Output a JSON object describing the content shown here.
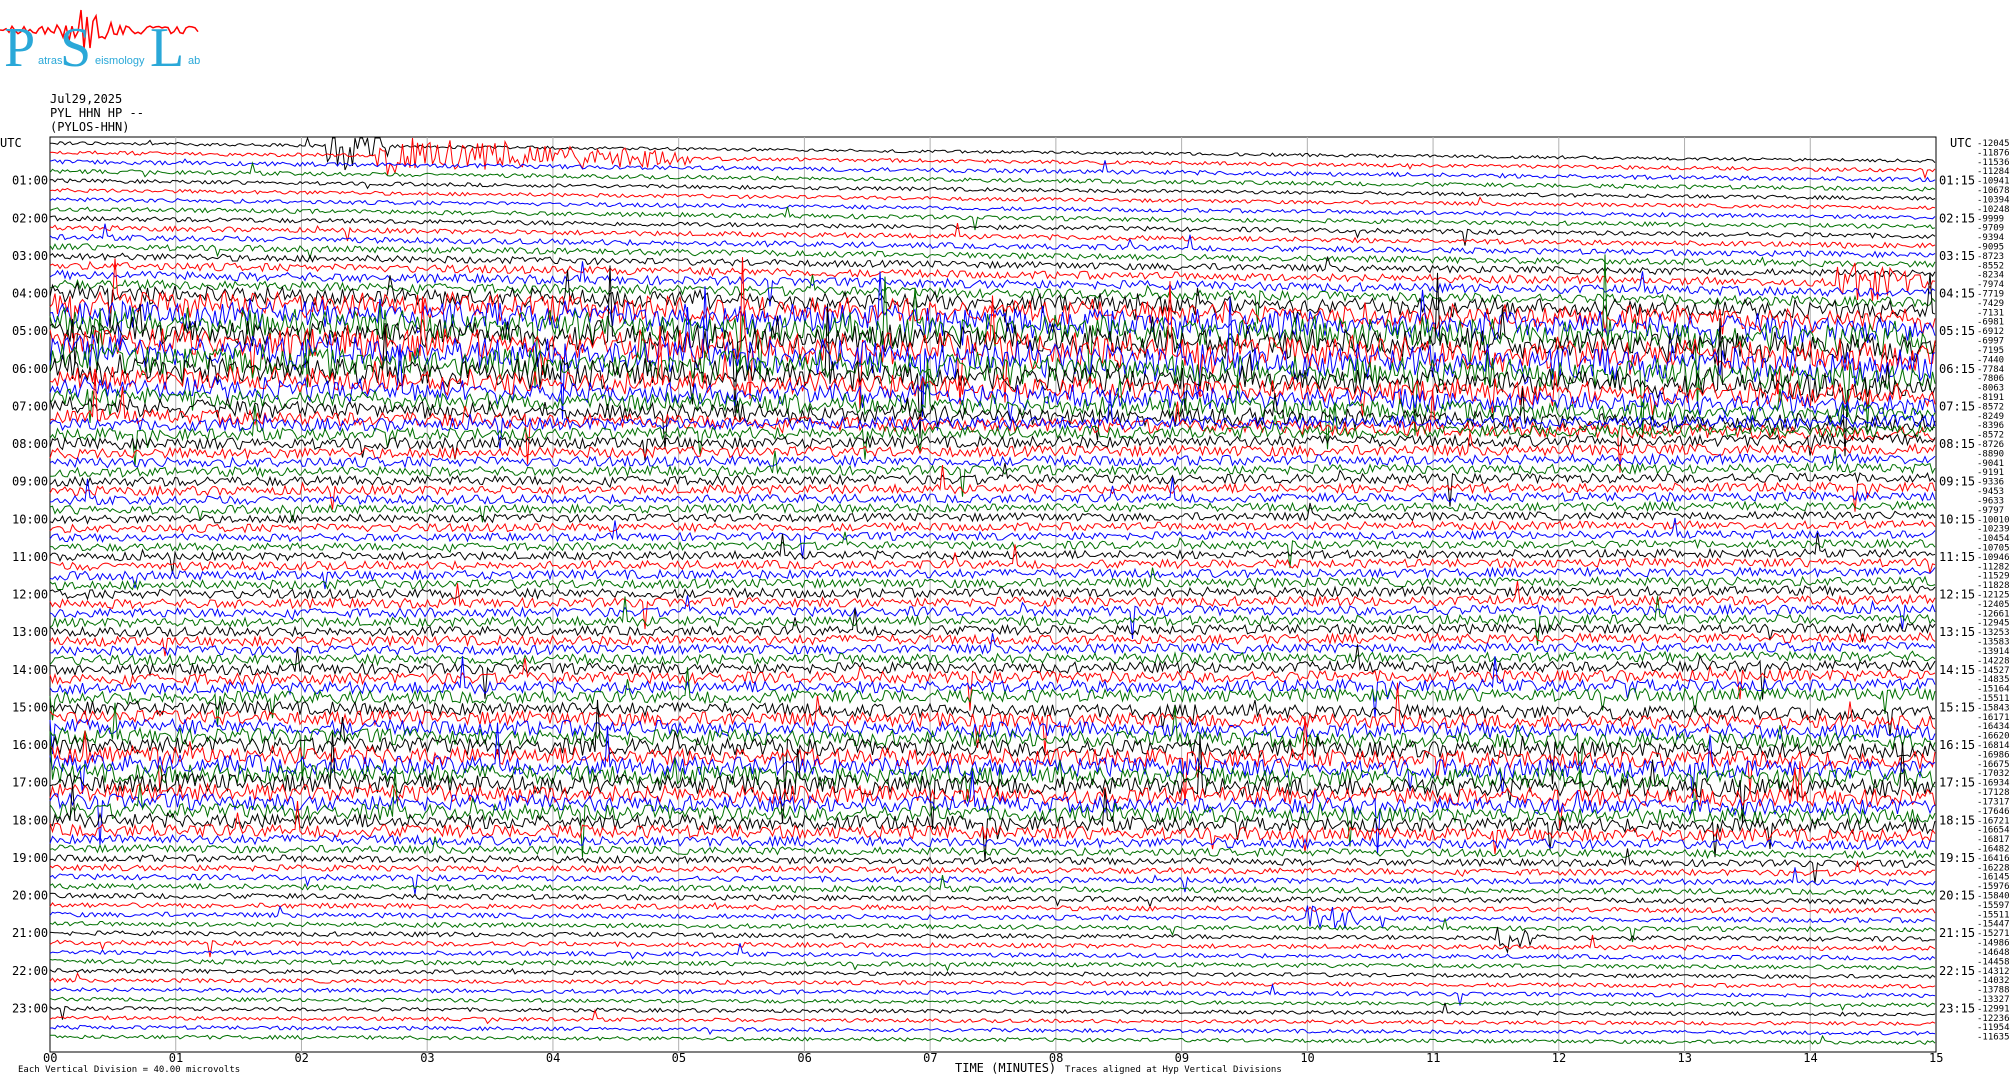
{
  "logo": {
    "letters": [
      "P",
      "S",
      "L"
    ],
    "small_words": [
      "atras",
      "eismology",
      "ab"
    ],
    "color": "#2aa8d8"
  },
  "header": {
    "date": "Jul29,2025",
    "station": "PYL HHN HP --",
    "network": "(PYLOS-HHN)"
  },
  "chart_data": {
    "type": "line",
    "left_axis_title": "UTC",
    "right_axis_title": "UTC",
    "left_hour_labels": [
      "01:00",
      "02:00",
      "03:00",
      "04:00",
      "05:00",
      "06:00",
      "07:00",
      "08:00",
      "09:00",
      "10:00",
      "11:00",
      "12:00",
      "13:00",
      "14:00",
      "15:00",
      "16:00",
      "17:00",
      "18:00",
      "19:00",
      "20:00",
      "21:00",
      "22:00",
      "23:00"
    ],
    "right_hour_labels": [
      "01:15",
      "02:15",
      "03:15",
      "04:15",
      "05:15",
      "06:15",
      "07:15",
      "08:15",
      "09:15",
      "10:15",
      "11:15",
      "12:15",
      "13:15",
      "14:15",
      "15:15",
      "16:15",
      "17:15",
      "18:15",
      "19:15",
      "20:15",
      "21:15",
      "22:15",
      "23:15"
    ],
    "x_tick_labels": [
      "00",
      "01",
      "02",
      "03",
      "04",
      "05",
      "06",
      "07",
      "08",
      "09",
      "10",
      "11",
      "12",
      "13",
      "14",
      "15"
    ],
    "xlabel": "TIME (MINUTES)",
    "xlim": [
      0,
      15
    ],
    "traces_count": 96,
    "trace_colors": [
      "#000000",
      "#ff0000",
      "#0000ff",
      "#007000"
    ],
    "right_trace_values": [
      "-12045",
      "-11876",
      "-11536",
      "-11284",
      "-10941",
      "-10678",
      "-10394",
      "-10248",
      "-9999",
      "-9709",
      "-9394",
      "-9095",
      "-8723",
      "-8552",
      "-8234",
      "-7974",
      "-7719",
      "-7429",
      "-7131",
      "-6981",
      "-6912",
      "-6997",
      "-7195",
      "-7440",
      "-7784",
      "-7806",
      "-8063",
      "-8191",
      "-8572",
      "-8249",
      "-8396",
      "-8572",
      "-8726",
      "-8890",
      "-9041",
      "-9191",
      "-9336",
      "-9453",
      "-9633",
      "-9797",
      "-10010",
      "-10239",
      "-10454",
      "-10705",
      "-10946",
      "-11282",
      "-11529",
      "-11828",
      "-12125",
      "-12405",
      "-12661",
      "-12945",
      "-13253",
      "-13583",
      "-13914",
      "-14228",
      "-14527",
      "-14835",
      "-15164",
      "-15511",
      "-15843",
      "-16171",
      "-16434",
      "-16620",
      "-16814",
      "-16986",
      "-16675",
      "-17032",
      "-16934",
      "-17128",
      "-17317",
      "-17646",
      "-16721",
      "-16654",
      "-16817",
      "-16482",
      "-16416",
      "-16228",
      "-16145",
      "-15976",
      "-15840",
      "-15597",
      "-15511",
      "-15447",
      "-15271",
      "-14986",
      "-14648",
      "-14458",
      "-14312",
      "-14032",
      "-13788",
      "-13327",
      "-12991",
      "-12236",
      "-11954",
      "-11635"
    ],
    "activity_profile": [
      1.0,
      1.2,
      1.4,
      1.3,
      1.2,
      1.2,
      1.3,
      1.4,
      1.5,
      1.6,
      1.8,
      2.0,
      2.2,
      2.5,
      2.8,
      3.0,
      5.0,
      7.0,
      8.0,
      8.5,
      8.0,
      9.0,
      9.5,
      8.5,
      7.5,
      6.5,
      6.0,
      5.5,
      5.0,
      4.5,
      4.0,
      3.8,
      3.6,
      3.4,
      3.2,
      3.0,
      3.0,
      2.9,
      2.8,
      2.7,
      2.6,
      2.6,
      2.5,
      2.5,
      2.6,
      2.7,
      2.8,
      2.9,
      3.0,
      3.0,
      3.0,
      3.0,
      3.0,
      3.0,
      3.0,
      3.2,
      3.4,
      3.6,
      3.8,
      4.0,
      4.2,
      4.5,
      4.8,
      5.0,
      5.2,
      5.5,
      5.8,
      6.0,
      6.0,
      5.5,
      5.0,
      4.8,
      4.5,
      4.0,
      3.0,
      2.5,
      2.2,
      2.0,
      1.8,
      1.8,
      1.7,
      1.6,
      1.6,
      1.5,
      1.5,
      1.5,
      1.4,
      1.4,
      1.3,
      1.3,
      1.3,
      1.2,
      1.2,
      1.2,
      1.2,
      1.2
    ],
    "events": [
      {
        "trace": 0,
        "minute": 2.2,
        "amplitude": 30,
        "duration": 0.5
      },
      {
        "trace": 1,
        "minute": 2.6,
        "amplitude": 20,
        "duration": 2.5
      },
      {
        "trace": 13,
        "minute": 14.2,
        "amplitude": 25,
        "duration": 0.8
      },
      {
        "trace": 22,
        "minute": 9.1,
        "amplitude": 35,
        "duration": 0.3
      },
      {
        "trace": 82,
        "minute": 10.0,
        "amplitude": 18,
        "duration": 0.4
      },
      {
        "trace": 84,
        "minute": 11.5,
        "amplitude": 20,
        "duration": 0.4
      }
    ]
  },
  "footer": {
    "division": "Each Vertical Division =    40.00 microvolts",
    "note": "Traces aligned at Hyp Vertical Divisions"
  }
}
